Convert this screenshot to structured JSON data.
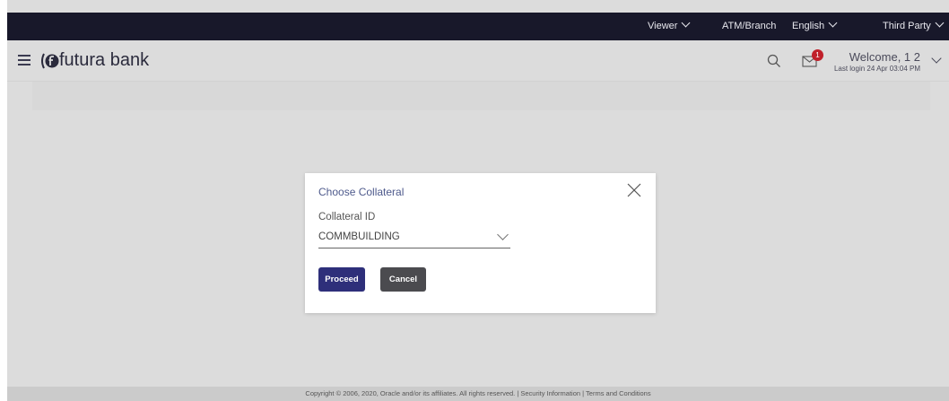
{
  "topbar": {
    "viewer": "Viewer",
    "atm_branch": "ATM/Branch",
    "language": "English",
    "third_party": "Third Party"
  },
  "header": {
    "brand": "futura bank",
    "mail_badge_count": "1",
    "welcome": "Welcome, 1 2",
    "last_login": "Last login 24 Apr 03:04 PM"
  },
  "modal": {
    "title": "Choose Collateral",
    "field_label": "Collateral ID",
    "selected_value": "COMMBUILDING",
    "proceed_label": "Proceed",
    "cancel_label": "Cancel"
  },
  "footer": {
    "text": "Copyright © 2006, 2020, Oracle and/or its affiliates. All rights reserved. | Security Information | Terms and Conditions"
  },
  "colors": {
    "topbar_bg": "#18182a",
    "primary_button": "#2e2f7a",
    "secondary_button": "#4b4b4f",
    "badge": "#c0202a",
    "title_text": "#4e5a8c"
  }
}
